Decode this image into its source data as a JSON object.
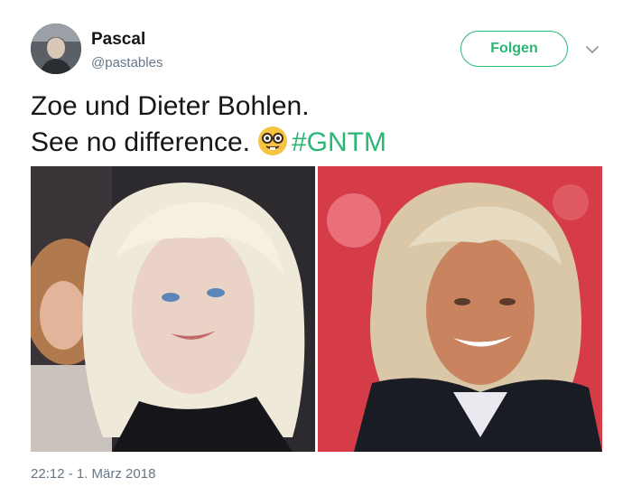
{
  "author": {
    "display_name": "Pascal",
    "handle": "@pastables",
    "avatar_icon": "user-avatar"
  },
  "follow_button": {
    "label": "Folgen"
  },
  "menu_icon": "chevron-down-icon",
  "tweet": {
    "line1": "Zoe und Dieter Bohlen.",
    "line2": "See no difference.",
    "emoji": "nerd-face-emoji",
    "hashtag": "#GNTM"
  },
  "media": [
    {
      "name": "photo-zoe"
    },
    {
      "name": "photo-dieter-bohlen"
    }
  ],
  "timestamp": "22:12 - 1. März 2018",
  "colors": {
    "accent": "#2ab673",
    "text": "#14171a",
    "secondary": "#657786"
  }
}
